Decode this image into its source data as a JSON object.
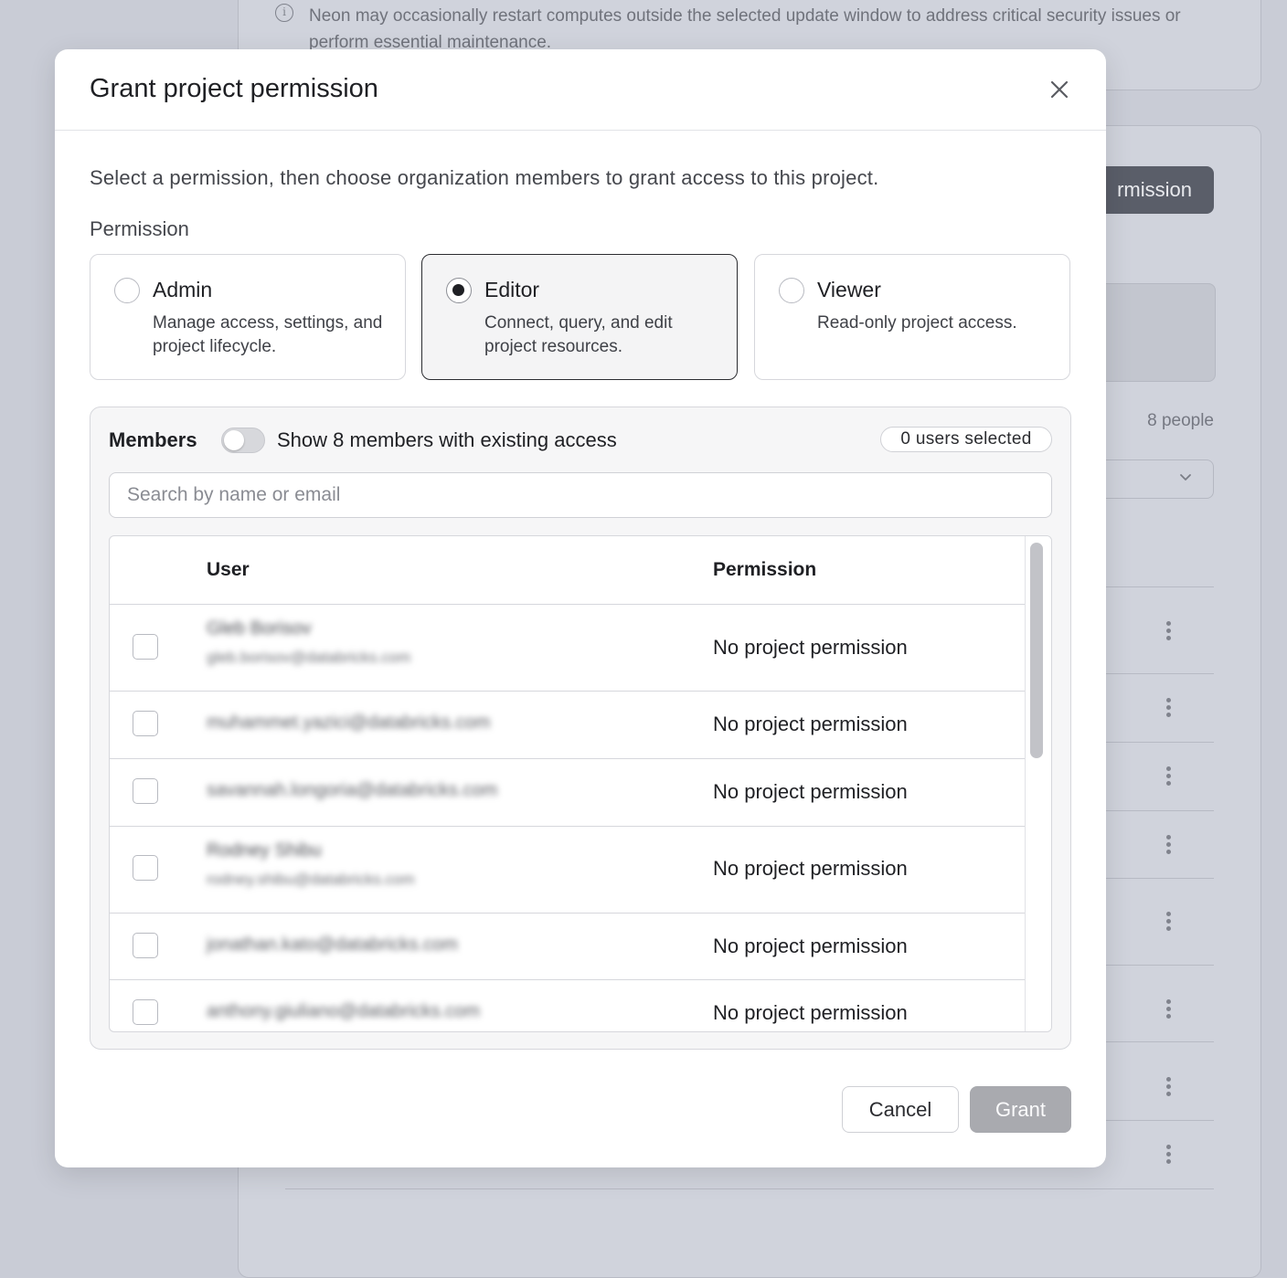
{
  "background": {
    "notice_text": "Neon may occasionally restart computes outside the selected update window to address critical security issues or perform essential maintenance.",
    "grant_button_fragment": "rmission",
    "people_count": "8 people"
  },
  "modal": {
    "title": "Grant project permission",
    "intro": "Select a permission, then choose organization members to grant access to this project.",
    "permission_label": "Permission",
    "permissions": [
      {
        "title": "Admin",
        "description": "Manage access, settings, and project lifecycle.",
        "selected": false
      },
      {
        "title": "Editor",
        "description": "Connect, query, and edit project resources.",
        "selected": true
      },
      {
        "title": "Viewer",
        "description": "Read-only project access.",
        "selected": false
      }
    ],
    "members": {
      "label": "Members",
      "toggle_label": "Show 8 members with existing access",
      "toggle_on": false,
      "selected_count": "0 users selected",
      "search_placeholder": "Search by name or email",
      "columns": {
        "user": "User",
        "permission": "Permission"
      },
      "rows": [
        {
          "name": "Gleb Borisov",
          "email": "gleb.borisov@databricks.com",
          "permission": "No project permission",
          "checked": false
        },
        {
          "name": "",
          "email": "muhammet.yazici@databricks.com",
          "permission": "No project permission",
          "checked": false
        },
        {
          "name": "",
          "email": "savannah.longoria@databricks.com",
          "permission": "No project permission",
          "checked": false
        },
        {
          "name": "Rodney Shibu",
          "email": "rodney.shibu@databricks.com",
          "permission": "No project permission",
          "checked": false
        },
        {
          "name": "",
          "email": "jonathan.kato@databricks.com",
          "permission": "No project permission",
          "checked": false
        },
        {
          "name": "",
          "email": "anthony.giuliano@databricks.com",
          "permission": "No project permission",
          "checked": false
        }
      ]
    },
    "buttons": {
      "cancel": "Cancel",
      "grant": "Grant"
    }
  }
}
